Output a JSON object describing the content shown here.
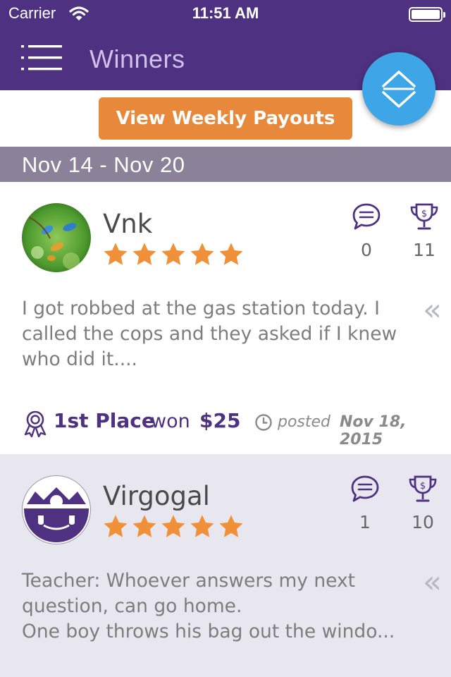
{
  "status_bar": {
    "carrier": "Carrier",
    "time": "11:51 AM"
  },
  "header": {
    "title": "Winners"
  },
  "payout_button": "View Weekly Payouts",
  "week_range": "Nov 14 - Nov 20",
  "colors": {
    "header": "#4e3180",
    "accent": "#e8883a",
    "fab": "#3ea6e6",
    "star": "#f0913a"
  },
  "posts": [
    {
      "username": "Vnk",
      "rating": 5,
      "comments": "0",
      "trophies": "11",
      "text": "I got robbed at the gas station today. I\ncalled the cops and they asked if I knew\nwho did it....",
      "place": "1st Place",
      "won_label": "won",
      "amount": "$25",
      "posted_label": "posted",
      "date": "Nov 18, 2015"
    },
    {
      "username": "Virgogal",
      "rating": 5,
      "comments": "1",
      "trophies": "10",
      "text": "Teacher: Whoever answers my next\nquestion, can go home.\nOne boy throws his bag out the windo..."
    }
  ],
  "icons": [
    "menu-icon",
    "sort-icon",
    "comment-icon",
    "trophy-icon",
    "chevron-left-double-icon",
    "ribbon-icon",
    "clock-icon",
    "star-icon",
    "wifi-icon",
    "battery-icon"
  ]
}
